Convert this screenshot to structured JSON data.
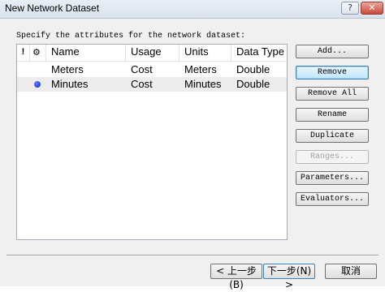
{
  "window": {
    "title": "New Network Dataset",
    "help_glyph": "?",
    "close_glyph": "✕"
  },
  "instruction": "Specify the attributes for the network dataset:",
  "table": {
    "headers": {
      "warning": "!",
      "default_icon": "⚙",
      "name": "Name",
      "usage": "Usage",
      "units": "Units",
      "data_type": "Data Type"
    },
    "rows": [
      {
        "is_default": false,
        "name": "Meters",
        "usage": "Cost",
        "units": "Meters",
        "data_type": "Double"
      },
      {
        "is_default": true,
        "name": "Minutes",
        "usage": "Cost",
        "units": "Minutes",
        "data_type": "Double"
      }
    ]
  },
  "buttons": {
    "add": "Add...",
    "remove": "Remove",
    "remove_all": "Remove All",
    "rename": "Rename",
    "duplicate": "Duplicate",
    "ranges": "Ranges...",
    "parameters": "Parameters...",
    "evaluators": "Evaluators..."
  },
  "footer": {
    "back": "< 上一步(B)",
    "next": "下一步(N) >",
    "cancel": "取消"
  }
}
